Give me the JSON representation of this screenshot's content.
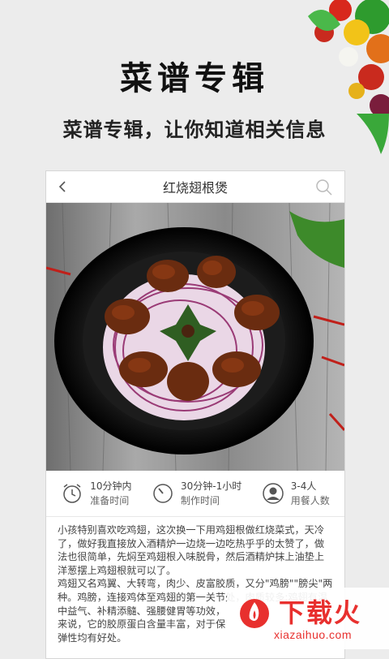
{
  "promo": {
    "title": "菜谱专辑",
    "subtitle": "菜谱专辑，让你知道相关信息"
  },
  "header": {
    "back_icon": "chevron-left-icon",
    "title": "红烧翅根煲",
    "search_icon": "search-icon"
  },
  "info": [
    {
      "icon": "alarm-clock-icon",
      "value": "10分钟内",
      "label": "准备时间"
    },
    {
      "icon": "timer-icon",
      "value": "30分钟-1小时",
      "label": "制作时间"
    },
    {
      "icon": "person-icon",
      "value": "3-4人",
      "label": "用餐人数"
    }
  ],
  "description": {
    "p1": "小孩特别喜欢吃鸡翅，这次换一下用鸡翅根做红烧菜式，天冷了，做好我直接放入酒精炉一边烧一边吃热乎乎的太赞了，做法也很简单，先焖至鸡翅根入味脱骨，然后酒精炉抹上油垫上洋葱摆上鸡翅根就可以了。",
    "p2": "鸡翅又名鸡翼、大转弯，肉少、皮富胶质，又分\"鸡膀\"\"膀尖\"两种。鸡膀，连接鸡体至鸡翅的第一关节处，肉质较多;鸡翅有温中益气、补精添髓、强腰健胃等功效，",
    "p3": "来说，它的胶原蛋白含量丰富，对于保",
    "p4": "弹性均有好处。"
  },
  "watermark": {
    "brand": "下载火",
    "url": "xiazaihuo.com"
  },
  "colors": {
    "accent": "#e8302e",
    "page_bg": "#ececec"
  }
}
